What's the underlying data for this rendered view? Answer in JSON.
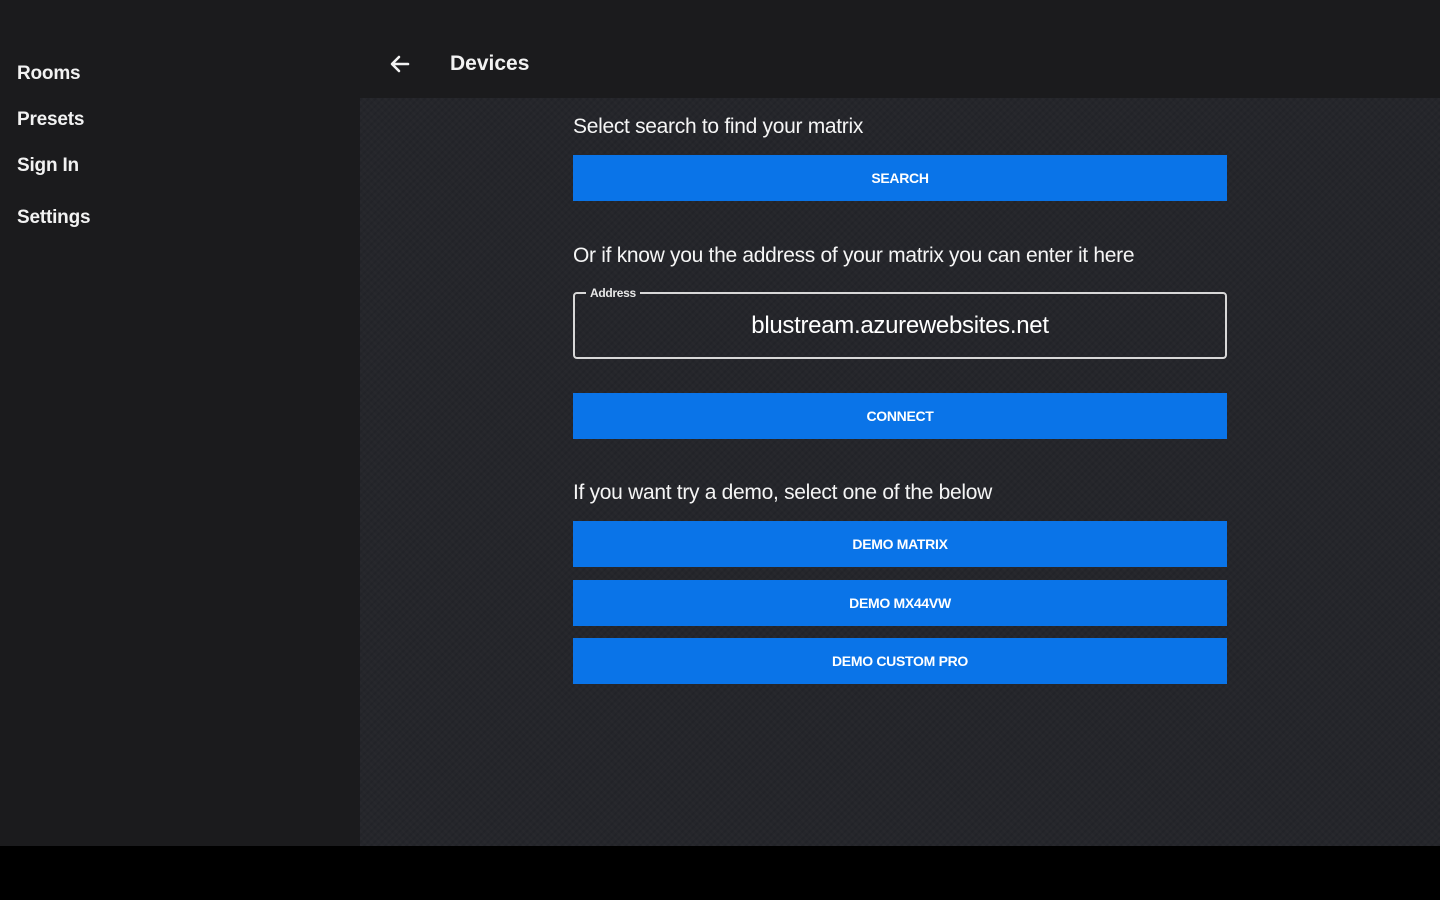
{
  "sidebar": {
    "items": [
      {
        "label": "Rooms"
      },
      {
        "label": "Presets"
      },
      {
        "label": "Sign In"
      },
      {
        "label": "Settings"
      }
    ]
  },
  "header": {
    "back_icon": "arrow-left-icon",
    "title": "Devices"
  },
  "main": {
    "search_prompt": "Select search to find your matrix",
    "search_button": "SEARCH",
    "address_prompt": "Or if know you the address of your matrix you can enter it here",
    "address_field": {
      "label": "Address",
      "value": "blustream.azurewebsites.net"
    },
    "connect_button": "CONNECT",
    "demo_prompt": "If you want try a demo, select one of the below",
    "demo_buttons": [
      "DEMO MATRIX",
      "DEMO MX44VW",
      "DEMO CUSTOM PRO"
    ]
  },
  "colors": {
    "accent": "#0a74e8",
    "sidebar_bg": "#1b1b1d",
    "content_bg": "#25262b"
  }
}
